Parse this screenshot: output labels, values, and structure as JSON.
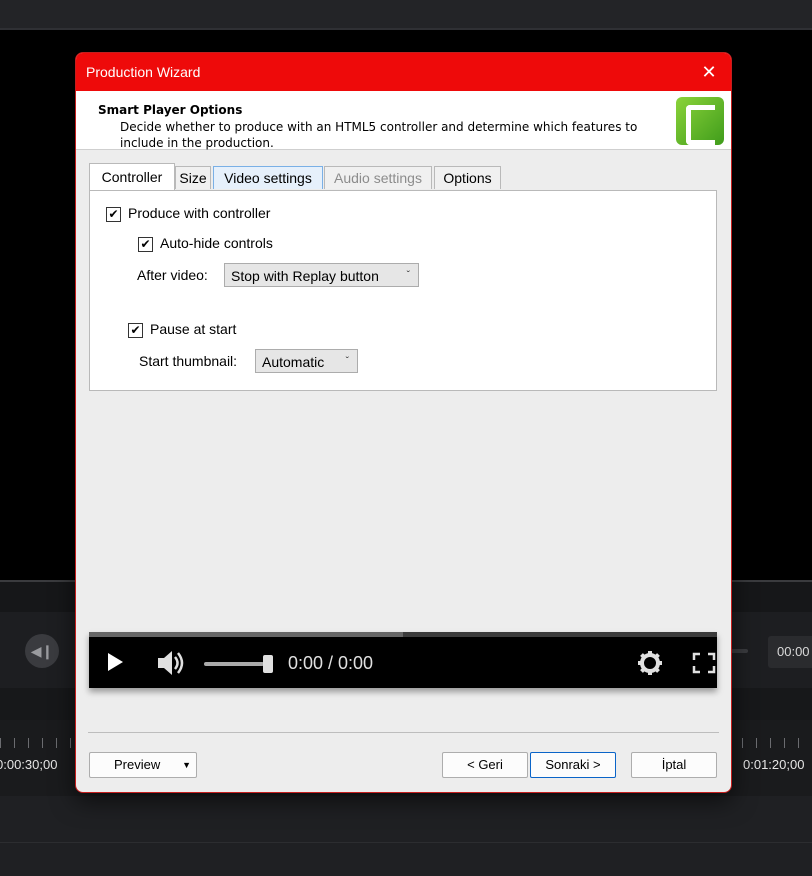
{
  "background": {
    "timestamp_left": "0:00:30;00",
    "timestamp_right": "0:01:20;00",
    "time_display": "00:00"
  },
  "dialog": {
    "title": "Production Wizard",
    "header_title": "Smart Player Options",
    "header_desc": "Decide whether to produce with an HTML5 controller and determine which features to include in the production.",
    "tabs": [
      {
        "label": "Controller"
      },
      {
        "label": "Size"
      },
      {
        "label": "Video settings"
      },
      {
        "label": "Audio settings"
      },
      {
        "label": "Options"
      }
    ],
    "controller": {
      "produce_label": "Produce with controller",
      "autohide_label": "Auto-hide controls",
      "after_video_label": "After video:",
      "after_video_value": "Stop with Replay button",
      "pause_label": "Pause at start",
      "start_thumb_label": "Start thumbnail:",
      "start_thumb_value": "Automatic"
    },
    "player": {
      "time": "0:00 / 0:00",
      "progress": 0.5
    },
    "buttons": {
      "preview": "Preview",
      "back": "< Geri",
      "next": "Sonraki >",
      "cancel": "İptal"
    }
  },
  "colors": {
    "titlebar": "#ee0a0a",
    "accent": "#0a64c8"
  }
}
